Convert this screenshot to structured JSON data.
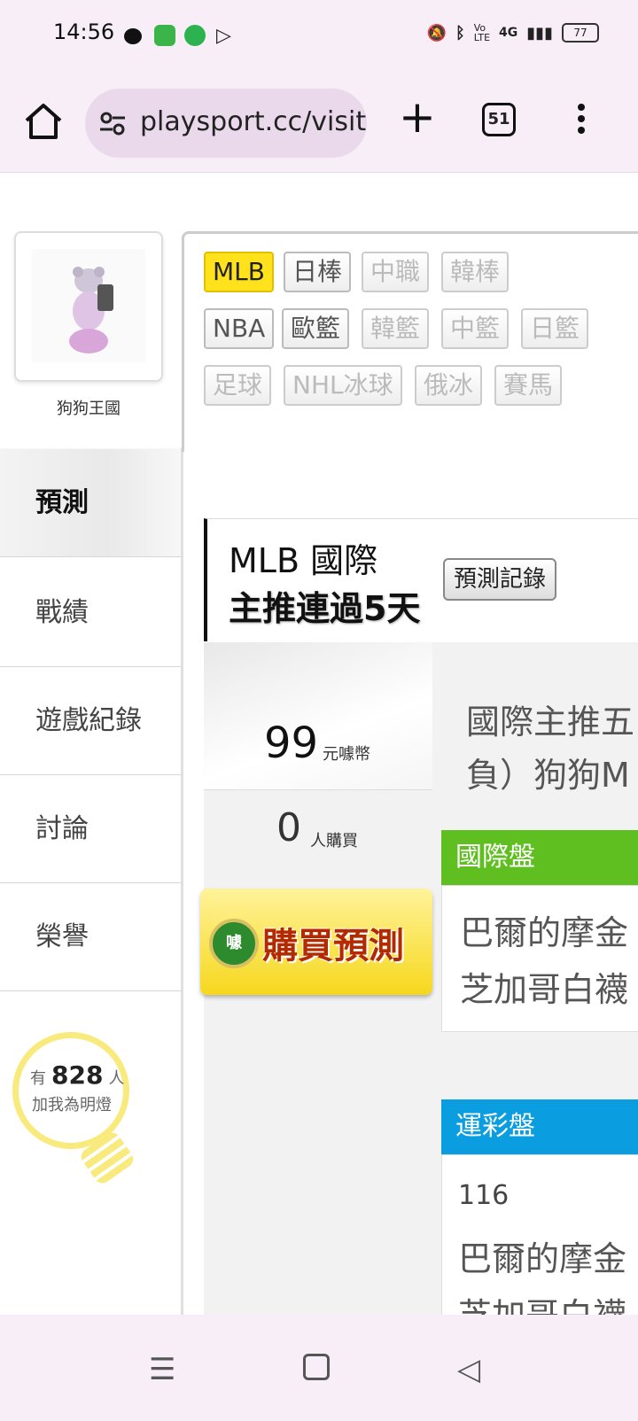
{
  "status_bar": {
    "time": "14:56",
    "right_icons": [
      "bell-mute-icon",
      "bluetooth-icon",
      "volte-icon",
      "signal-4g-icon"
    ],
    "network": "4G",
    "battery": "77"
  },
  "browser": {
    "url": "playsport.cc/visit",
    "tab_count": "51",
    "new_tab_label": "+"
  },
  "profile": {
    "name": "狗狗王國"
  },
  "sidebar": {
    "items": [
      {
        "label": "預測"
      },
      {
        "label": "戰績"
      },
      {
        "label": "遊戲紀錄"
      },
      {
        "label": "討論"
      },
      {
        "label": "榮譽"
      }
    ]
  },
  "fans": {
    "prefix": "有",
    "count": "828",
    "suffix": "人",
    "line2": "加我為明燈"
  },
  "tags": {
    "row1": [
      "MLB",
      "日棒",
      "中職",
      "韓棒"
    ],
    "row2": [
      "NBA",
      "歐籃",
      "韓籃",
      "中籃",
      "日籃"
    ],
    "row3": [
      "足球",
      "NHL冰球",
      "俄冰",
      "賽馬"
    ]
  },
  "headline": {
    "title": "MLB 國際",
    "subtitle": "主推連過5天",
    "record_button": "預測記錄"
  },
  "prediction": {
    "price": "99",
    "price_unit": "元噱幣",
    "buyers": "0",
    "buyers_unit": "人購買",
    "buy_button": "購買預測",
    "buy_logo": "噱",
    "desc_line1": "國際主推五",
    "desc_line2": "負）狗狗M"
  },
  "international": {
    "header": "國際盤",
    "team1": "巴爾的摩金",
    "team2": "芝加哥白襪"
  },
  "lottery": {
    "header": "運彩盤",
    "number": "116",
    "team1": "巴爾的摩金",
    "team2": "芝加哥白襪"
  },
  "colors": {
    "selected_tag": "#ffe21c",
    "international_header": "#5fbf20",
    "lottery_header": "#0a9de0",
    "buy_button": "#f6d71d",
    "bulb": "#f9ea7d"
  }
}
